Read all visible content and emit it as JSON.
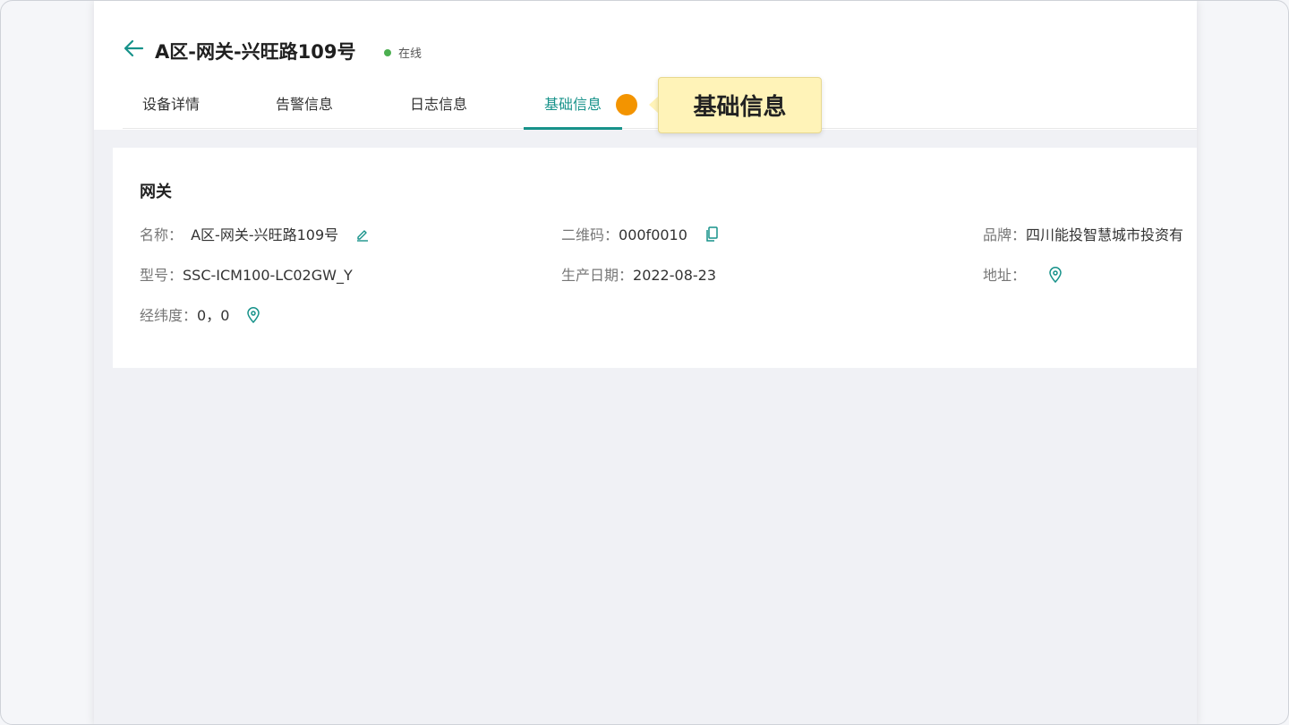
{
  "header": {
    "title": "A区-网关-兴旺路109号",
    "status": "在线"
  },
  "tabs": [
    {
      "label": "设备详情"
    },
    {
      "label": "告警信息"
    },
    {
      "label": "日志信息"
    },
    {
      "label": "基础信息"
    }
  ],
  "tooltip": {
    "text": "基础信息"
  },
  "card": {
    "title": "网关",
    "fields": {
      "name": {
        "label": "名称：",
        "value": "A区-网关-兴旺路109号"
      },
      "qrcode": {
        "label": "二维码：",
        "value": "000f0010"
      },
      "brand": {
        "label": "品牌：",
        "value": "四川能投智慧城市投资有"
      },
      "model": {
        "label": "型号：",
        "value": "SSC-ICM100-LC02GW_Y"
      },
      "production_date": {
        "label": "生产日期：",
        "value": "2022-08-23"
      },
      "address": {
        "label": "地址：",
        "value": ""
      },
      "coords": {
        "label": "经纬度：",
        "value": "0，0"
      }
    }
  },
  "colors": {
    "accent": "#17928a",
    "status_online": "#4caf50",
    "highlight_dot": "#f39400",
    "tooltip_bg": "#fff3b8"
  },
  "icons": {
    "back": "arrow-left-icon",
    "edit": "pencil-icon",
    "copy": "copy-icon",
    "location": "map-pin-icon"
  }
}
